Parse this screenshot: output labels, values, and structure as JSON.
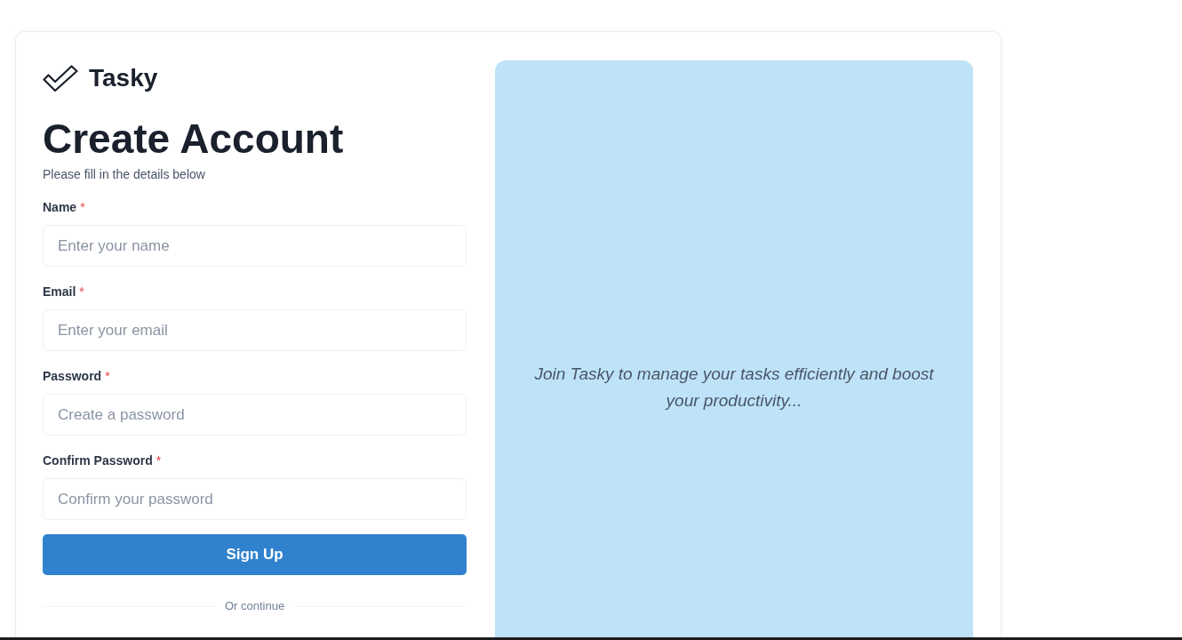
{
  "brand": {
    "name": "Tasky"
  },
  "heading": "Create Account",
  "subtitle": "Please fill in the details below",
  "fields": [
    {
      "label": "Name",
      "required_mark": "*",
      "placeholder": "Enter your name"
    },
    {
      "label": "Email",
      "required_mark": "*",
      "placeholder": "Enter your email"
    },
    {
      "label": "Password",
      "required_mark": "*",
      "placeholder": "Create a password"
    },
    {
      "label": "Confirm Password",
      "required_mark": "*",
      "placeholder": "Confirm your password"
    }
  ],
  "submit_button": "Sign Up",
  "divider_text": "Or continue",
  "promo": {
    "text": "Join Tasky to manage your tasks efficiently and boost your productivity..."
  }
}
